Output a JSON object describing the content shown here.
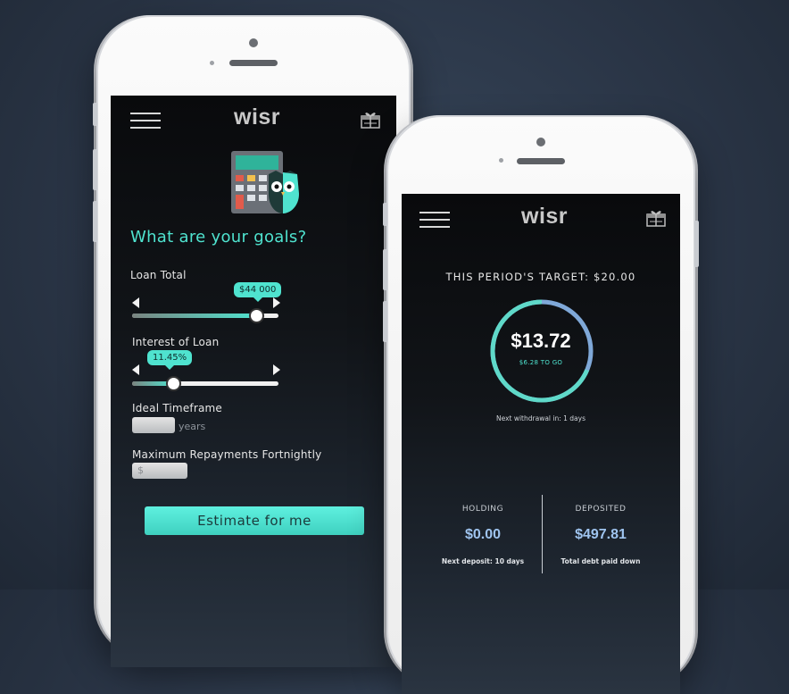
{
  "phone_left": {
    "logo": "wisr",
    "heading": "What are your goals?",
    "loan_total": {
      "label": "Loan Total",
      "value": "$44 000",
      "level": 0.85
    },
    "interest": {
      "label": "Interest of Loan",
      "value": "11.45%",
      "level": 0.28
    },
    "timeframe": {
      "label": "Ideal Timeframe",
      "unit": "years",
      "value": ""
    },
    "repayments": {
      "label": "Maximum Repayments Fortnightly",
      "placeholder": "$"
    },
    "cta": "Estimate for me"
  },
  "phone_right": {
    "logo": "wisr",
    "target": "THIS PERIOD'S TARGET: $20.00",
    "current": "$13.72",
    "to_go": "$6.28 TO GO",
    "progress": 0.686,
    "next_withdrawal": "Next withdrawal in: 1 days",
    "holding": {
      "label": "HOLDING",
      "value": "$0.00",
      "note": "Next deposit: 10 days"
    },
    "deposited": {
      "label": "DEPOSITED",
      "value": "$497.81",
      "note": "Total debt paid down"
    }
  },
  "colors": {
    "accent": "#4fe3cf",
    "ring_blue": "#7fa8d8",
    "value_blue": "#9fc4ef"
  },
  "icons": [
    "menu-icon",
    "gift-icon",
    "calculator-owl-icon",
    "arrow-left-icon",
    "arrow-right-icon"
  ]
}
